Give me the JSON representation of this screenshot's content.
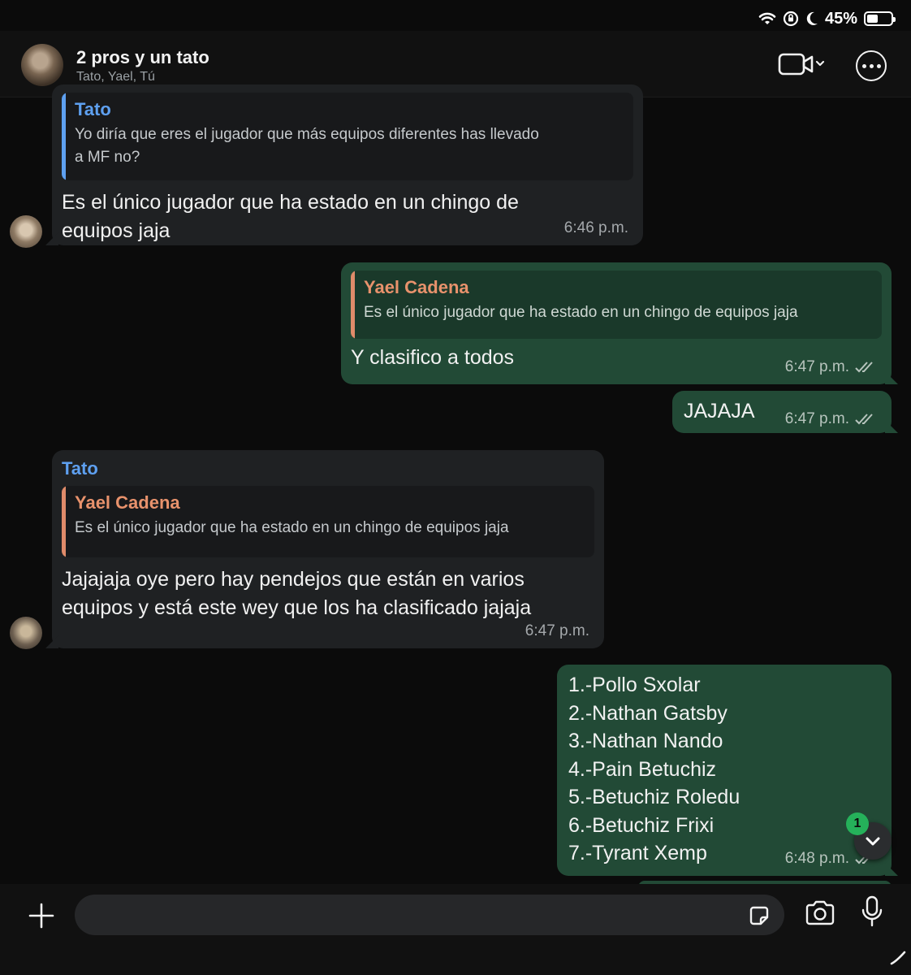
{
  "status_bar": {
    "battery": "45%",
    "battery_level": 0.45
  },
  "header": {
    "title": "2 pros y un tato",
    "members": "Tato, Yael, Tú"
  },
  "messages": [
    {
      "quote_name": "Tato",
      "quote_text_line1": "Yo diría que eres el jugador que más equipos diferentes has llevado",
      "quote_text_line2": "a MF no?",
      "text_line1": "Es el único jugador que ha estado en un chingo de",
      "text_line2": "equipos jaja",
      "time": "6:46 p.m."
    },
    {
      "quote_name": "Yael Cadena",
      "quote_text": "Es el único jugador que ha estado en un chingo de equipos jaja",
      "text": "Y clasifico a todos",
      "time": "6:47 p.m."
    },
    {
      "text": "JAJAJA",
      "time": "6:47 p.m."
    },
    {
      "sender": "Tato",
      "quote_name": "Yael Cadena",
      "quote_text": "Es el único jugador que ha estado en un chingo de equipos jaja",
      "text_line1": "Jajajaja oye pero hay pendejos que están en varios",
      "text_line2": "equipos y está este wey que los ha clasificado jajaja",
      "time": "6:47 p.m."
    },
    {
      "lines": [
        "1.-Pollo Sxolar",
        "2.-Nathan Gatsby",
        "3.-Nathan Nando",
        "4.-Pain Betuchiz",
        "5.-Betuchiz Roledu",
        "6.-Betuchiz Frixi",
        "7.-Tyrant Xemp"
      ],
      "time": "6:48 p.m."
    }
  ],
  "scroll_badge": "1",
  "colors": {
    "incoming_bubble": "#1f2123",
    "outgoing_bubble": "#224a36",
    "quote_blue": "#5ea0f0",
    "quote_orange": "#e8926c",
    "unread_badge": "#25b15a"
  }
}
